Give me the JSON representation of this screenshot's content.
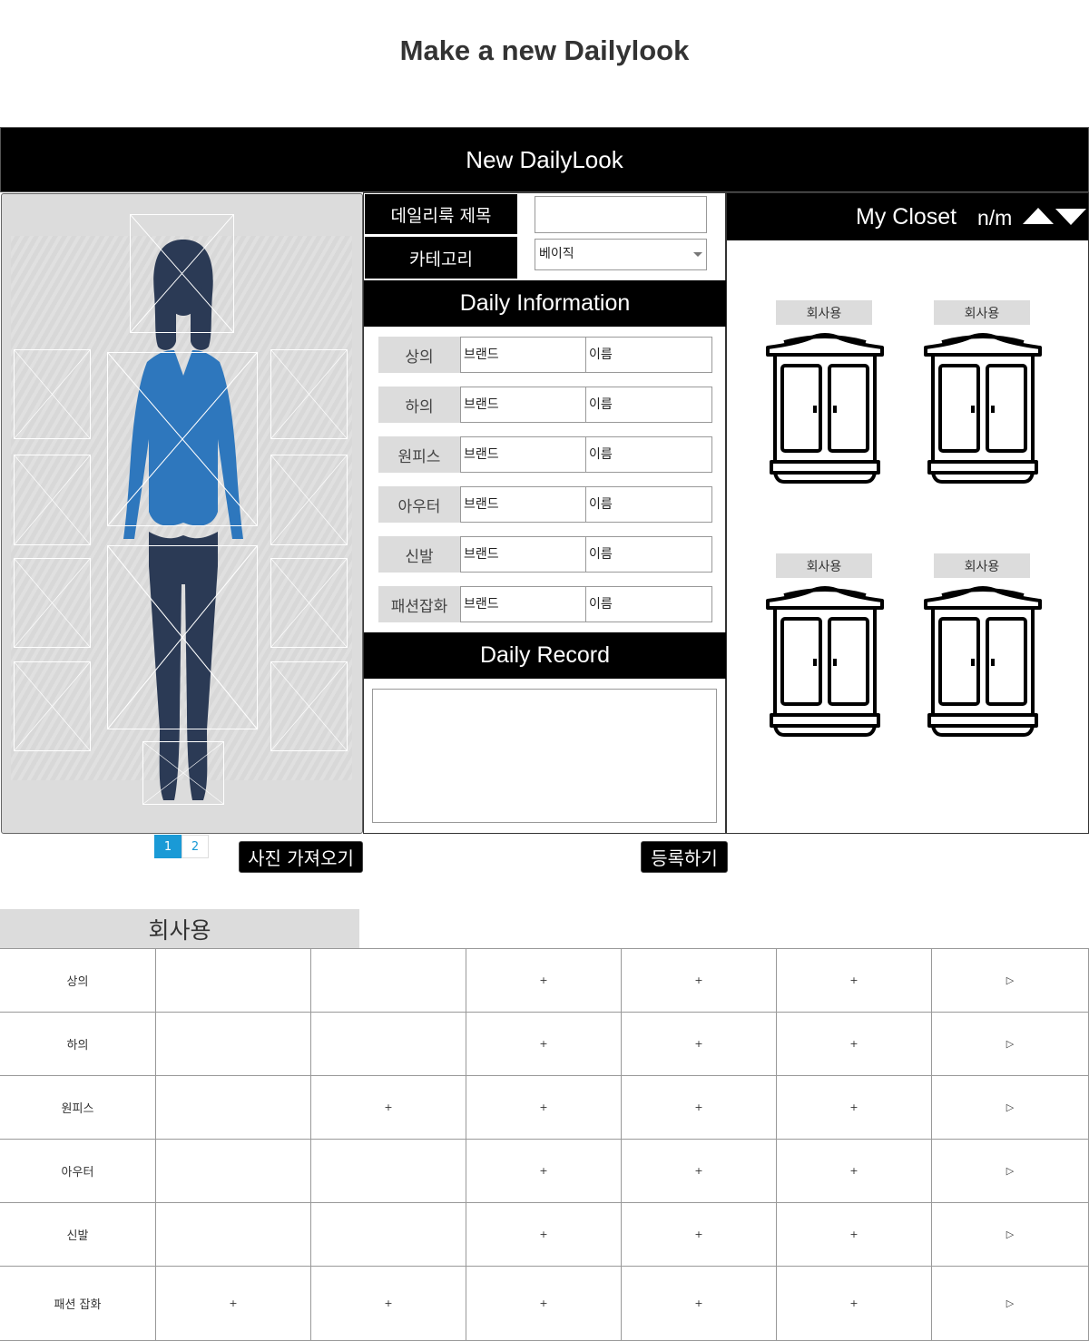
{
  "page": {
    "title": "Make a new Dailylook"
  },
  "header": {
    "title": "New DailyLook"
  },
  "figure": {
    "silhouette": "woman-figure",
    "colors": {
      "hair": "#2b3a55",
      "top": "#2e77bd",
      "pants": "#2b3a55",
      "background": "#dcdcdc"
    }
  },
  "form": {
    "title_label": "데일리룩 제목",
    "title_value": "",
    "category_label": "카테고리",
    "category_value": "베이직"
  },
  "daily_info": {
    "heading": "Daily Information",
    "rows": [
      {
        "category": "상의",
        "brand": "브랜드",
        "name": "이름"
      },
      {
        "category": "하의",
        "brand": "브랜드",
        "name": "이름"
      },
      {
        "category": "원피스",
        "brand": "브랜드",
        "name": "이름"
      },
      {
        "category": "아우터",
        "brand": "브랜드",
        "name": "이름"
      },
      {
        "category": "신발",
        "brand": "브랜드",
        "name": "이름"
      },
      {
        "category": "패션잡화",
        "brand": "브랜드",
        "name": "이름"
      }
    ]
  },
  "daily_record": {
    "heading": "Daily Record",
    "value": ""
  },
  "closet": {
    "heading": "My Closet",
    "counter": "n/m",
    "icons": [
      "up-arrow-icon",
      "down-arrow-icon"
    ],
    "wardrobes": [
      {
        "label": "회사용",
        "icon": "wardrobe-icon"
      },
      {
        "label": "회사용",
        "icon": "wardrobe-icon"
      },
      {
        "label": "회사용",
        "icon": "wardrobe-icon"
      },
      {
        "label": "회사용",
        "icon": "wardrobe-icon"
      }
    ]
  },
  "pager": {
    "pages": [
      "1",
      "2"
    ],
    "active": "1"
  },
  "buttons": {
    "import_photo": "사진 가져오기",
    "register": "등록하기"
  },
  "table": {
    "title": "회사용",
    "rows": [
      {
        "label": "상의",
        "cells": [
          "",
          "",
          "+",
          "+",
          "+",
          "▷"
        ]
      },
      {
        "label": "하의",
        "cells": [
          "",
          "",
          "+",
          "+",
          "+",
          "▷"
        ]
      },
      {
        "label": "원피스",
        "cells": [
          "",
          "+",
          "+",
          "+",
          "+",
          "▷"
        ]
      },
      {
        "label": "아우터",
        "cells": [
          "",
          "",
          "+",
          "+",
          "+",
          "▷"
        ]
      },
      {
        "label": "신발",
        "cells": [
          "",
          "",
          "+",
          "+",
          "+",
          "▷"
        ]
      },
      {
        "label": "패션 잡화",
        "cells": [
          "+",
          "+",
          "+",
          "+",
          "+",
          "▷"
        ]
      }
    ]
  }
}
